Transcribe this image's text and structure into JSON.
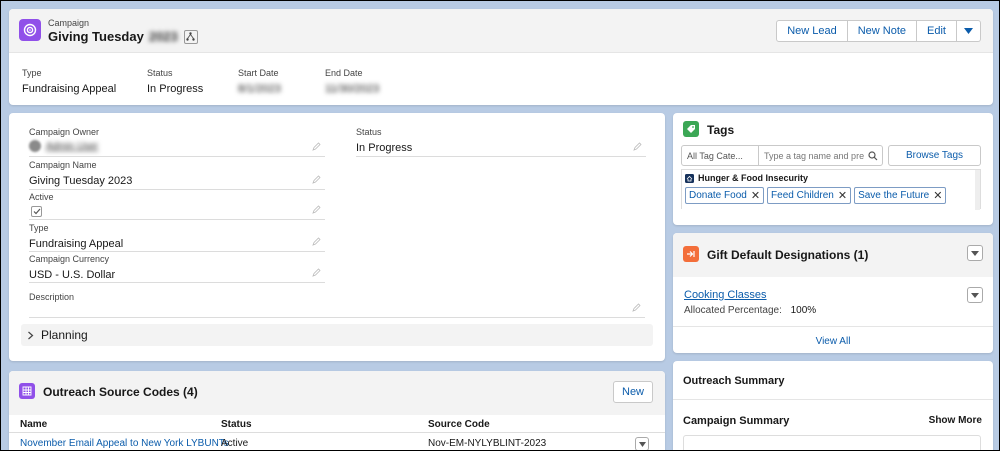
{
  "header": {
    "object_label": "Campaign",
    "title": "Giving Tuesday",
    "title_year_blurred": "2023",
    "actions": [
      "New Lead",
      "New Note",
      "Edit"
    ]
  },
  "highlights": [
    {
      "label": "Type",
      "value": "Fundraising Appeal"
    },
    {
      "label": "Status",
      "value": "In Progress"
    },
    {
      "label": "Start Date",
      "value": "8/1/2023"
    },
    {
      "label": "End Date",
      "value": "11/30/2023"
    }
  ],
  "details": {
    "owner_label": "Campaign Owner",
    "owner_value": "Admin User",
    "name_label": "Campaign Name",
    "name_value": "Giving Tuesday 2023",
    "active_label": "Active",
    "type_label": "Type",
    "type_value": "Fundraising Appeal",
    "currency_label": "Campaign Currency",
    "currency_value": "USD - U.S. Dollar",
    "description_label": "Description",
    "status_label": "Status",
    "status_value": "In Progress",
    "planning_label": "Planning"
  },
  "tags": {
    "title": "Tags",
    "category_placeholder": "All Tag Cate...",
    "search_placeholder": "Type a tag name and press Enter",
    "browse_label": "Browse Tags",
    "group_name": "Hunger & Food Insecurity",
    "items": [
      "Donate Food",
      "Feed Children",
      "Save the Future"
    ]
  },
  "gift": {
    "title": "Gift Default Designations (1)",
    "item_name": "Cooking Classes",
    "allocated_label": "Allocated Percentage:",
    "allocated_value": "100%",
    "view_all": "View All"
  },
  "outreach_summary": {
    "title": "Outreach Summary"
  },
  "campaign_summary": {
    "title": "Campaign Summary",
    "show_more": "Show More"
  },
  "source_codes": {
    "title": "Outreach Source Codes (4)",
    "new_label": "New",
    "columns": [
      "Name",
      "Status",
      "Source Code"
    ],
    "rows": [
      {
        "name": "November Email Appeal to New York LYBUNTs",
        "status": "Active",
        "code": "Nov-EM-NYLYBLINT-2023"
      }
    ]
  },
  "colors": {
    "campaign_icon": "#9050e9",
    "tags_icon": "#3ba755",
    "gift_icon": "#f36e3a",
    "source_icon": "#9050e9",
    "link": "#0b5cab"
  }
}
